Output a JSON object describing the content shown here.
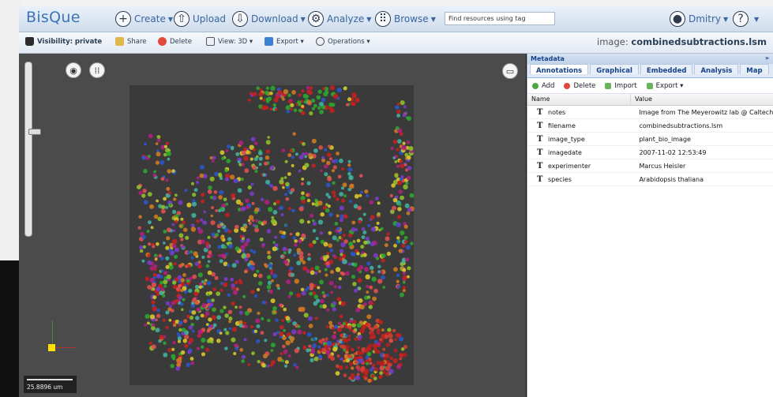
{
  "app": {
    "logo": "BisQue",
    "nav": [
      {
        "label": "Create",
        "icon": "plus-circle-icon",
        "glyph": "+"
      },
      {
        "label": "Upload",
        "icon": "upload-icon",
        "glyph": "⇧"
      },
      {
        "label": "Download",
        "icon": "download-icon",
        "glyph": "⇩"
      },
      {
        "label": "Analyze",
        "icon": "analyze-icon",
        "glyph": "⚙"
      },
      {
        "label": "Browse",
        "icon": "browse-icon",
        "glyph": "⠿"
      }
    ],
    "search_value": "Find resources using tag",
    "user": "Dmitry",
    "help_glyph": "?"
  },
  "toolbar": {
    "visibility_label": "Visibility:",
    "visibility_value": "private",
    "share": "Share",
    "delete": "Delete",
    "view": "View: 3D",
    "export": "Export",
    "operations": "Operations",
    "image_prefix": "image:",
    "image_name": "combinedsubtractions.lsm"
  },
  "viewer": {
    "scale_label": "25.8896 um"
  },
  "metadata": {
    "title": "Metadata",
    "collapse_glyph": "»",
    "tabs": [
      "Annotations",
      "Graphical",
      "Embedded",
      "Analysis",
      "Map"
    ],
    "actions": {
      "add": "Add",
      "delete": "Delete",
      "import": "Import",
      "export": "Export"
    },
    "columns": {
      "name": "Name",
      "value": "Value"
    },
    "rows": [
      {
        "type": "T",
        "name": "notes",
        "value": "Image from The Meyerowitz lab @ Caltech"
      },
      {
        "type": "T",
        "name": "filename",
        "value": "combinedsubtractions.lsm"
      },
      {
        "type": "T",
        "name": "image_type",
        "value": "plant_bio_image"
      },
      {
        "type": "T",
        "name": "imagedate",
        "value": "2007-11-02 12:53:49"
      },
      {
        "type": "T",
        "name": "experimenter",
        "value": "Marcus Heisler"
      },
      {
        "type": "T",
        "name": "species",
        "value": "Arabidopsis thaliana"
      }
    ]
  },
  "colors": {
    "brand": "#3c74b6",
    "header_text": "#15428b",
    "viewer_bg": "#4b4b4b"
  }
}
